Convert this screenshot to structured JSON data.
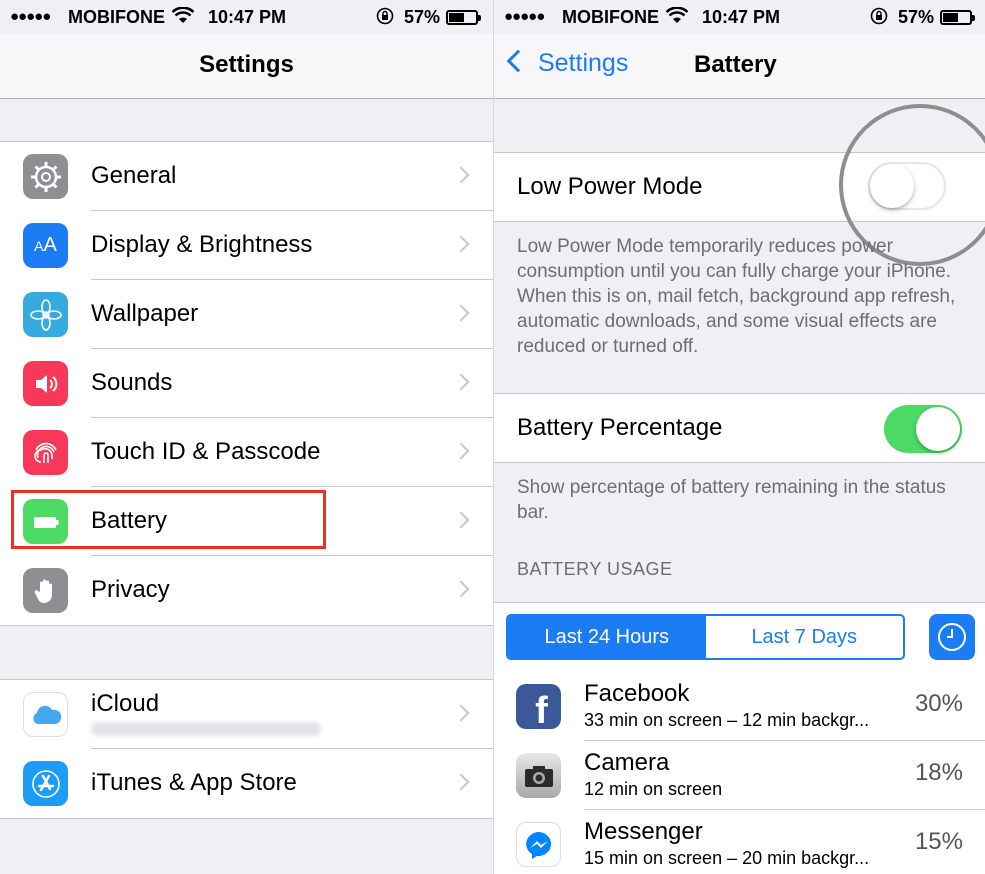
{
  "status_bar": {
    "signal": "●●●●●",
    "carrier": "MOBIFONE",
    "time": "10:47 PM",
    "battery_percent": "57%"
  },
  "left": {
    "title": "Settings",
    "group1": [
      {
        "label": "General",
        "icon": "gear-icon",
        "color": "#8e8e93"
      },
      {
        "label": "Display & Brightness",
        "icon": "text-size-icon",
        "color": "#1c7cf4"
      },
      {
        "label": "Wallpaper",
        "icon": "flower-icon",
        "color": "#35aadc"
      },
      {
        "label": "Sounds",
        "icon": "speaker-icon",
        "color": "#f73859"
      },
      {
        "label": "Touch ID & Passcode",
        "icon": "fingerprint-icon",
        "color": "#f73859"
      },
      {
        "label": "Battery",
        "icon": "battery-icon",
        "color": "#4cd964"
      },
      {
        "label": "Privacy",
        "icon": "hand-icon",
        "color": "#8e8e93"
      }
    ],
    "group2": [
      {
        "label": "iCloud",
        "icon": "cloud-icon",
        "color": "#ffffff"
      },
      {
        "label": "iTunes & App Store",
        "icon": "app-store-icon",
        "color": "#1c9cf4"
      }
    ]
  },
  "right": {
    "back_label": "Settings",
    "title": "Battery",
    "low_power_label": "Low Power Mode",
    "low_power_on": false,
    "low_power_footer": "Low Power Mode temporarily reduces power consumption until you can fully charge your iPhone. When this is on, mail fetch, background app refresh, automatic downloads, and some visual effects are reduced or turned off.",
    "percentage_label": "Battery Percentage",
    "percentage_on": true,
    "percentage_footer": "Show percentage of battery remaining in the status bar.",
    "usage_header": "BATTERY USAGE",
    "segments": [
      "Last 24 Hours",
      "Last 7 Days"
    ],
    "selected_segment": 0,
    "apps": [
      {
        "name": "Facebook",
        "detail": "33 min on screen – 12 min backgr...",
        "percent": "30%",
        "icon": "facebook-icon"
      },
      {
        "name": "Camera",
        "detail": "12 min on screen",
        "percent": "18%",
        "icon": "camera-icon"
      },
      {
        "name": "Messenger",
        "detail": "15 min on screen – 20 min backgr...",
        "percent": "15%",
        "icon": "messenger-icon"
      }
    ]
  },
  "colors": {
    "accent": "#1c7cf4",
    "switch_on": "#4cd964",
    "highlight": "#e8331e"
  }
}
